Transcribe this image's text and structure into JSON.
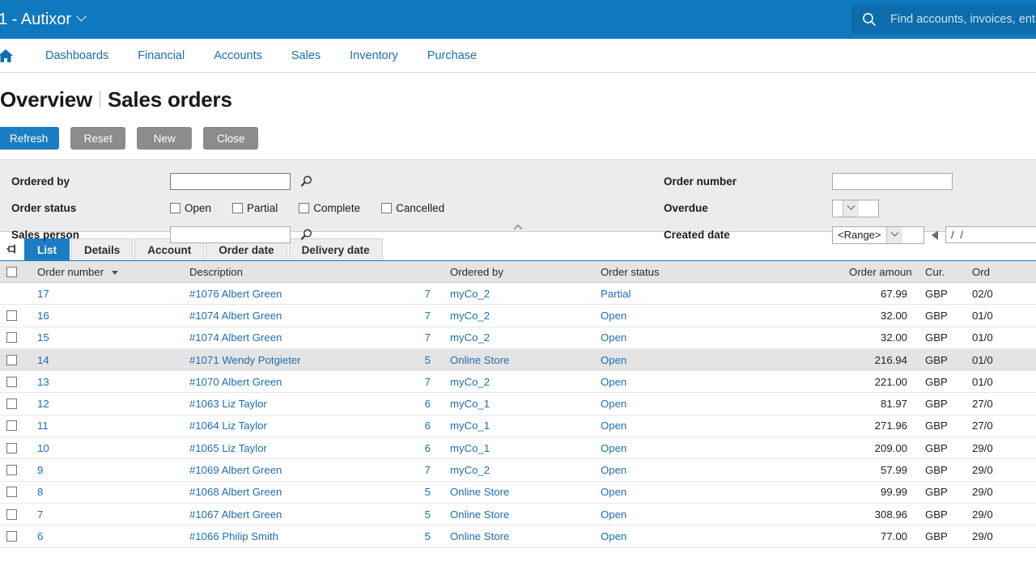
{
  "topbar": {
    "company": "1 - Autixor",
    "search_placeholder": "Find accounts, invoices, entries",
    "search_value": ""
  },
  "nav": {
    "home_icon": "home-icon",
    "items": [
      {
        "label": "Dashboards"
      },
      {
        "label": "Financial"
      },
      {
        "label": "Accounts"
      },
      {
        "label": "Sales"
      },
      {
        "label": "Inventory"
      },
      {
        "label": "Purchase"
      }
    ]
  },
  "page": {
    "breadcrumb": "Overview",
    "title": "Sales orders"
  },
  "toolbar": {
    "refresh_label": "Refresh",
    "reset_label": "Reset",
    "new_label": "New",
    "close_label": "Close"
  },
  "filters": {
    "ordered_by_label": "Ordered by",
    "ordered_by_value": "",
    "order_status_label": "Order status",
    "status_options": [
      {
        "label": "Open",
        "checked": false
      },
      {
        "label": "Partial",
        "checked": false
      },
      {
        "label": "Complete",
        "checked": false
      },
      {
        "label": "Cancelled",
        "checked": false
      }
    ],
    "sales_person_label": "Sales person",
    "sales_person_value": "",
    "order_number_label": "Order number",
    "order_number_value": "",
    "overdue_label": "Overdue",
    "overdue_value": "",
    "created_date_label": "Created date",
    "created_date_range": "<Range>",
    "created_date_value": "/ /"
  },
  "tabs": {
    "pin_icon": "pin-icon",
    "items": [
      {
        "label": "List",
        "active": true
      },
      {
        "label": "Details",
        "active": false
      },
      {
        "label": "Account",
        "active": false
      },
      {
        "label": "Order date",
        "active": false
      },
      {
        "label": "Delivery date",
        "active": false
      }
    ]
  },
  "table": {
    "columns": {
      "order_number": "Order number",
      "description": "Description",
      "ordered_by": "Ordered by",
      "order_status": "Order status",
      "order_amount": "Order amount (+VAT)",
      "currency": "Cur.",
      "order_date": "Ord"
    },
    "sorted_by": "order_number",
    "rows": [
      {
        "num": "17",
        "desc": "#1076 Albert Green",
        "by_num": "7",
        "by_name": "myCo_2",
        "status": "Partial",
        "amount": "67.99",
        "cur": "GBP",
        "date": "02/0",
        "selected": false,
        "checkbox": false
      },
      {
        "num": "16",
        "desc": "#1074 Albert Green",
        "by_num": "7",
        "by_name": "myCo_2",
        "status": "Open",
        "amount": "32.00",
        "cur": "GBP",
        "date": "01/0",
        "selected": false,
        "checkbox": true
      },
      {
        "num": "15",
        "desc": "#1074 Albert Green",
        "by_num": "7",
        "by_name": "myCo_2",
        "status": "Open",
        "amount": "32.00",
        "cur": "GBP",
        "date": "01/0",
        "selected": false,
        "checkbox": true
      },
      {
        "num": "14",
        "desc": "#1071 Wendy Potgieter",
        "by_num": "5",
        "by_name": "Online Store",
        "status": "Open",
        "amount": "216.94",
        "cur": "GBP",
        "date": "01/0",
        "selected": true,
        "checkbox": true
      },
      {
        "num": "13",
        "desc": "#1070 Albert Green",
        "by_num": "7",
        "by_name": "myCo_2",
        "status": "Open",
        "amount": "221.00",
        "cur": "GBP",
        "date": "01/0",
        "selected": false,
        "checkbox": true
      },
      {
        "num": "12",
        "desc": "#1063 Liz Taylor",
        "by_num": "6",
        "by_name": "myCo_1",
        "status": "Open",
        "amount": "81.97",
        "cur": "GBP",
        "date": "27/0",
        "selected": false,
        "checkbox": true
      },
      {
        "num": "11",
        "desc": "#1064 Liz Taylor",
        "by_num": "6",
        "by_name": "myCo_1",
        "status": "Open",
        "amount": "271.96",
        "cur": "GBP",
        "date": "27/0",
        "selected": false,
        "checkbox": true
      },
      {
        "num": "10",
        "desc": "#1065 Liz Taylor",
        "by_num": "6",
        "by_name": "myCo_1",
        "status": "Open",
        "amount": "209.00",
        "cur": "GBP",
        "date": "29/0",
        "selected": false,
        "checkbox": true
      },
      {
        "num": "9",
        "desc": "#1069 Albert Green",
        "by_num": "7",
        "by_name": "myCo_2",
        "status": "Open",
        "amount": "57.99",
        "cur": "GBP",
        "date": "29/0",
        "selected": false,
        "checkbox": true
      },
      {
        "num": "8",
        "desc": "#1068 Albert Green",
        "by_num": "5",
        "by_name": "Online Store",
        "status": "Open",
        "amount": "99.99",
        "cur": "GBP",
        "date": "29/0",
        "selected": false,
        "checkbox": true
      },
      {
        "num": "7",
        "desc": "#1067 Albert Green",
        "by_num": "5",
        "by_name": "Online Store",
        "status": "Open",
        "amount": "308.96",
        "cur": "GBP",
        "date": "29/0",
        "selected": false,
        "checkbox": true
      },
      {
        "num": "6",
        "desc": "#1066 Philip Smith",
        "by_num": "5",
        "by_name": "Online Store",
        "status": "Open",
        "amount": "77.00",
        "cur": "GBP",
        "date": "29/0",
        "selected": false,
        "checkbox": true
      }
    ]
  },
  "colors": {
    "header_blue": "#1078be",
    "accent_blue": "#1b7dc4",
    "link_blue": "#1b6fb5",
    "button_gray": "#8c8c8c",
    "filter_bg": "#ececec"
  }
}
